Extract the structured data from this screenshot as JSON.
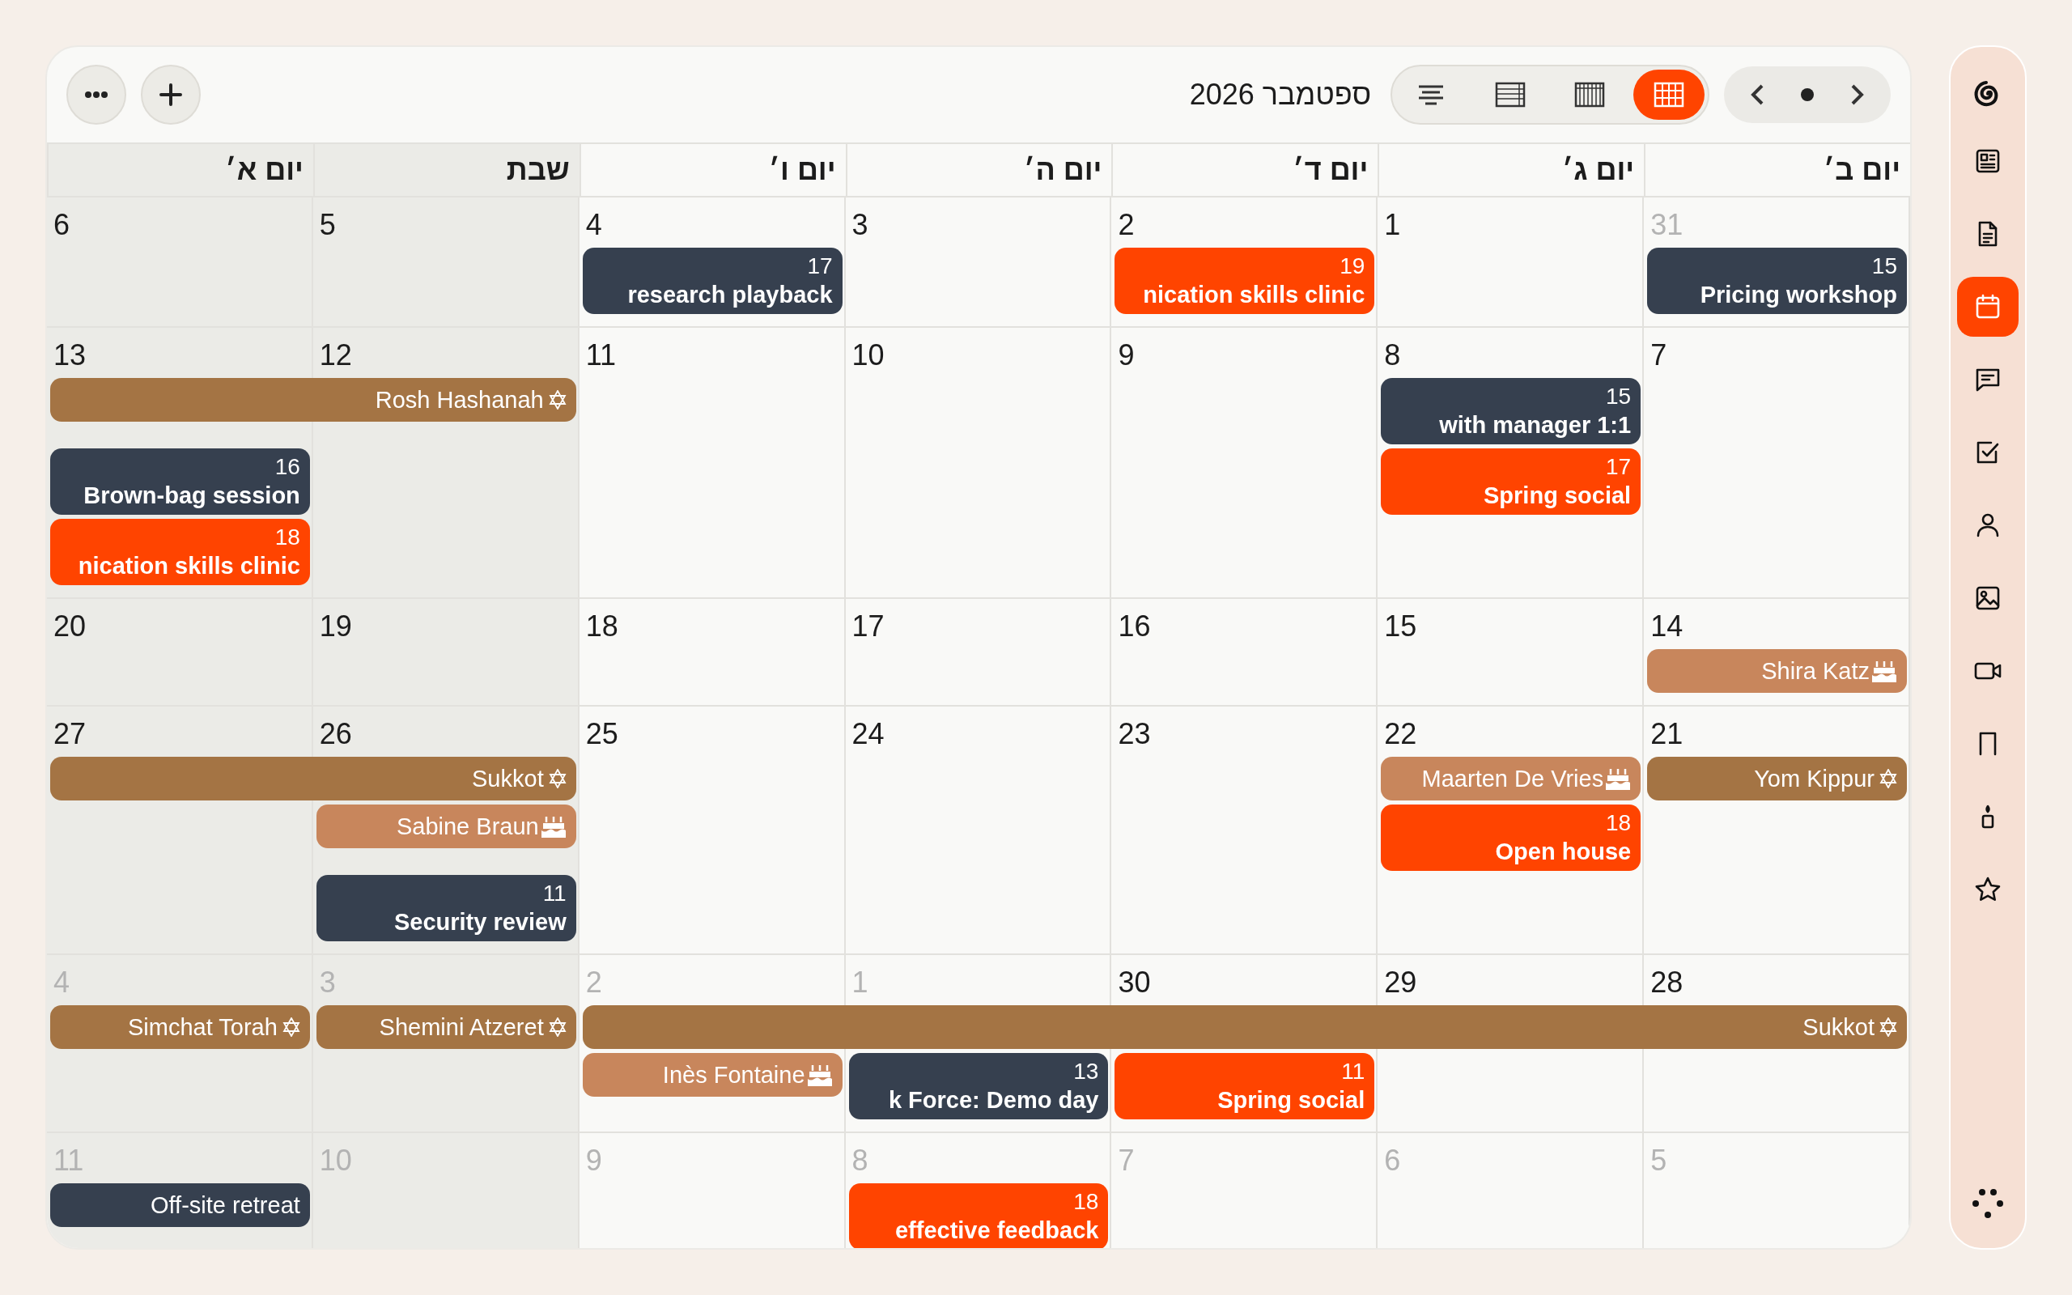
{
  "toolbar": {
    "title": "ספטמבר 2026",
    "views": [
      {
        "kind": "filter",
        "selected": false
      },
      {
        "kind": "list",
        "selected": false
      },
      {
        "kind": "columns",
        "selected": false
      },
      {
        "kind": "grid",
        "selected": true
      }
    ]
  },
  "sidebar": {
    "items": [
      {
        "kind": "newspaper",
        "selected": false
      },
      {
        "kind": "document",
        "selected": false
      },
      {
        "kind": "calendar",
        "selected": true
      },
      {
        "kind": "chat",
        "selected": false
      },
      {
        "kind": "task",
        "selected": false
      },
      {
        "kind": "person",
        "selected": false
      },
      {
        "kind": "image",
        "selected": false
      },
      {
        "kind": "video",
        "selected": false
      },
      {
        "kind": "bookmark",
        "selected": false
      },
      {
        "kind": "candle",
        "selected": false
      },
      {
        "kind": "star",
        "selected": false
      }
    ]
  },
  "columns": [
    {
      "label": "יום ב׳",
      "weekend": false
    },
    {
      "label": "יום ג׳",
      "weekend": false
    },
    {
      "label": "יום ד׳",
      "weekend": false
    },
    {
      "label": "יום ה׳",
      "weekend": false
    },
    {
      "label": "יום ו׳",
      "weekend": false
    },
    {
      "label": "שבת",
      "weekend": true
    },
    {
      "label": "יום א׳",
      "weekend": true
    }
  ],
  "weeks": [
    {
      "days": [
        {
          "label": "6",
          "muted": false
        },
        {
          "label": "5",
          "muted": false
        },
        {
          "label": "4",
          "muted": false,
          "events": [
            {
              "kind": "timed",
              "time": "17",
              "title": "research playback",
              "color": "#36404f"
            }
          ]
        },
        {
          "label": "3",
          "muted": false
        },
        {
          "label": "2",
          "muted": false,
          "events": [
            {
              "kind": "timed",
              "time": "19",
              "title": "nication skills clinic",
              "color": "#ff4400"
            }
          ]
        },
        {
          "label": "1",
          "muted": false
        },
        {
          "label": "31",
          "muted": true,
          "events": [
            {
              "kind": "timed",
              "time": "15",
              "title": "Pricing workshop",
              "color": "#36404f"
            }
          ]
        }
      ]
    },
    {
      "days": [
        {
          "label": "13",
          "muted": false,
          "events": [
            {
              "kind": "holiday",
              "title": "Rosh Hashanah",
              "color": "#a47444"
            },
            {
              "kind": "timed",
              "time": "16",
              "title": "Brown-bag session",
              "color": "#36404f"
            },
            {
              "kind": "timed",
              "time": "18",
              "title": "nication skills clinic",
              "color": "#ff4400"
            }
          ]
        },
        {
          "label": "12",
          "muted": false,
          "events": [
            {
              "kind": "continuation"
            }
          ]
        },
        {
          "label": "11",
          "muted": false
        },
        {
          "label": "10",
          "muted": false
        },
        {
          "label": "9",
          "muted": false
        },
        {
          "label": "8",
          "muted": false,
          "events": [
            {
              "kind": "timed",
              "time": "15",
              "title": "with manager 1:1",
              "color": "#36404f"
            },
            {
              "kind": "timed",
              "time": "17",
              "title": "Spring social",
              "color": "#ff4400"
            }
          ]
        },
        {
          "label": "7",
          "muted": false
        }
      ]
    },
    {
      "days": [
        {
          "label": "20",
          "muted": false
        },
        {
          "label": "19",
          "muted": false
        },
        {
          "label": "18",
          "muted": false
        },
        {
          "label": "17",
          "muted": false
        },
        {
          "label": "16",
          "muted": false
        },
        {
          "label": "15",
          "muted": false
        },
        {
          "label": "14",
          "muted": false,
          "events": [
            {
              "kind": "birthday",
              "title": "Shira Katz",
              "color": "#c8865c"
            }
          ]
        }
      ]
    },
    {
      "days": [
        {
          "label": "27",
          "muted": false,
          "events": [
            {
              "kind": "holiday",
              "title": "Sukkot",
              "color": "#a47444"
            }
          ]
        },
        {
          "label": "26",
          "muted": false,
          "events": [
            {
              "kind": "continuation"
            },
            {
              "kind": "birthday",
              "title": "Sabine Braun",
              "color": "#c8865c"
            },
            {
              "kind": "timed",
              "time": "11",
              "title": "Security review",
              "color": "#36404f"
            }
          ]
        },
        {
          "label": "25",
          "muted": false
        },
        {
          "label": "24",
          "muted": false
        },
        {
          "label": "23",
          "muted": false
        },
        {
          "label": "22",
          "muted": false,
          "events": [
            {
              "kind": "birthday",
              "title": "Maarten De Vries",
              "color": "#c8865c"
            },
            {
              "kind": "timed",
              "time": "18",
              "title": "Open house",
              "color": "#ff4400"
            }
          ]
        },
        {
          "label": "21",
          "muted": false,
          "events": [
            {
              "kind": "holiday",
              "title": "Yom Kippur",
              "color": "#a47444"
            }
          ]
        }
      ]
    },
    {
      "days": [
        {
          "label": "4",
          "muted": true,
          "events": [
            {
              "kind": "holiday",
              "title": "Simchat Torah",
              "color": "#a47444"
            }
          ]
        },
        {
          "label": "3",
          "muted": true,
          "events": [
            {
              "kind": "holiday",
              "title": "Shemini Atzeret",
              "color": "#a47444"
            }
          ]
        },
        {
          "label": "2",
          "muted": true,
          "events": [
            {
              "kind": "holiday",
              "title": "Sukkot",
              "color": "#a47444"
            },
            {
              "kind": "birthday",
              "title": "Inès Fontaine",
              "color": "#c8865c"
            }
          ]
        },
        {
          "label": "1",
          "muted": true,
          "events": [
            {
              "kind": "continuation"
            },
            {
              "kind": "timed",
              "time": "13",
              "title": "k Force: Demo day",
              "color": "#36404f"
            }
          ]
        },
        {
          "label": "30",
          "muted": false,
          "events": [
            {
              "kind": "continuation"
            },
            {
              "kind": "timed",
              "time": "11",
              "title": "Spring social",
              "color": "#ff4400"
            }
          ]
        },
        {
          "label": "29",
          "muted": false,
          "events": [
            {
              "kind": "continuation"
            }
          ]
        },
        {
          "label": "28",
          "muted": false,
          "events": [
            {
              "kind": "continuation"
            }
          ]
        }
      ]
    },
    {
      "days": [
        {
          "label": "11",
          "muted": true,
          "events": [
            {
              "kind": "timed",
              "title": "Off-site retreat",
              "color": "#36404f"
            }
          ]
        },
        {
          "label": "10",
          "muted": true
        },
        {
          "label": "9",
          "muted": true
        },
        {
          "label": "8",
          "muted": true,
          "events": [
            {
              "kind": "timed",
              "time": "18",
              "title": "effective feedback",
              "color": "#ff4400"
            }
          ]
        },
        {
          "label": "7",
          "muted": true
        },
        {
          "label": "6",
          "muted": true
        },
        {
          "label": "5",
          "muted": true
        }
      ]
    }
  ]
}
